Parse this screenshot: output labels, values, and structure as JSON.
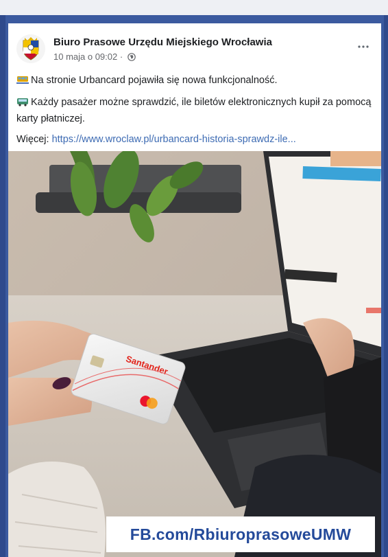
{
  "post": {
    "page_name": "Biuro Prasowe Urzędu Miejskiego Wrocławia",
    "timestamp": "10 maja o 09:02 ·",
    "privacy_icon": "globe-icon",
    "more_icon": "more-options-icon",
    "paragraphs": [
      "Na stronie Urbancard pojawiła się nowa funkcjonalność.",
      "Każdy pasażer możne sprawdzić, ile biletów elektronicznych kupił za pomocą karty płatniczej."
    ],
    "emoji_icons": [
      "tram-icon",
      "bus-icon"
    ],
    "more_label": "Więcej: ",
    "link_text": "https://www.wroclaw.pl/urbancard-historia-sprawdz-ile..."
  },
  "photo": {
    "card_brand": "Santander",
    "watermark": "FB.com/RbiuroprasoweUMW"
  },
  "colors": {
    "frame": "#3b5a9f",
    "link": "#3d6bb3",
    "watermark_text": "#244a9a",
    "card_accent": "#e2231a"
  }
}
